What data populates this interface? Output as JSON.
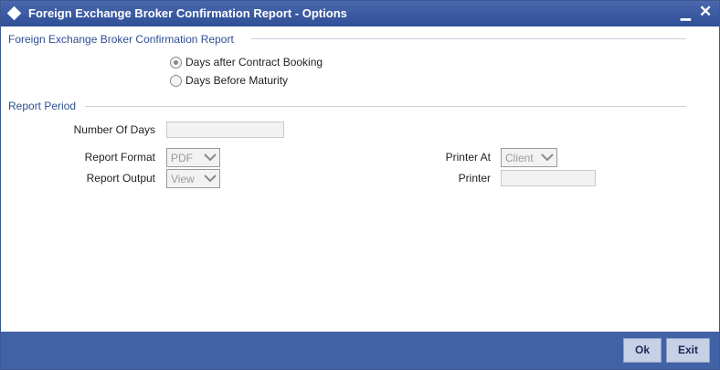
{
  "window": {
    "title": "Foreign Exchange Broker Confirmation Report - Options",
    "minimize_label": "▁",
    "close_label": "✕"
  },
  "report_section": {
    "title": "Foreign Exchange Broker Confirmation Report",
    "options": [
      {
        "label": "Days after Contract Booking",
        "selected": true
      },
      {
        "label": "Days Before Maturity",
        "selected": false
      }
    ]
  },
  "period_section": {
    "title": "Report Period",
    "number_of_days_label": "Number Of Days",
    "number_of_days_value": ""
  },
  "output": {
    "format_label": "Report Format",
    "format_value": "PDF",
    "output_label": "Report Output",
    "output_value": "View",
    "printer_at_label": "Printer At",
    "printer_at_value": "Client",
    "printer_label": "Printer",
    "printer_value": ""
  },
  "footer": {
    "ok_label": "Ok",
    "exit_label": "Exit"
  },
  "colors": {
    "titlebar": "#2f4f97",
    "section_text": "#2e4f94",
    "footer": "#4262a6",
    "button": "#c6d1e6"
  }
}
